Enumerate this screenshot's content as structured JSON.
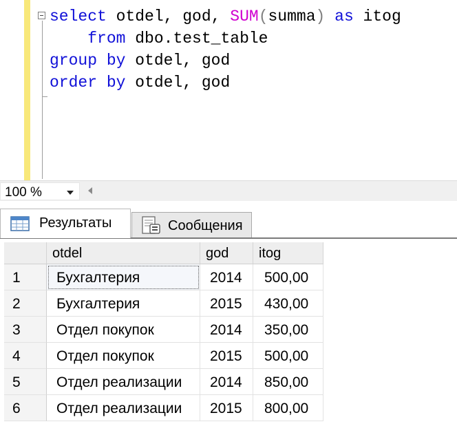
{
  "editor": {
    "lines": [
      {
        "parts": [
          {
            "t": "select",
            "c": "kw"
          },
          {
            "t": " otdel, god, ",
            "c": ""
          },
          {
            "t": "SUM",
            "c": "fn"
          },
          {
            "t": "(",
            "c": "op"
          },
          {
            "t": "summa",
            "c": ""
          },
          {
            "t": ")",
            "c": "op"
          },
          {
            "t": " ",
            "c": ""
          },
          {
            "t": "as",
            "c": "kw"
          },
          {
            "t": " itog",
            "c": ""
          }
        ]
      },
      {
        "parts": [
          {
            "t": "    ",
            "c": ""
          },
          {
            "t": "from",
            "c": "kw"
          },
          {
            "t": " dbo.test_table",
            "c": ""
          }
        ]
      },
      {
        "parts": [
          {
            "t": "group by",
            "c": "kw"
          },
          {
            "t": " otdel, god",
            "c": ""
          }
        ]
      },
      {
        "parts": [
          {
            "t": "order by",
            "c": "kw"
          },
          {
            "t": " otdel, god",
            "c": ""
          }
        ]
      }
    ]
  },
  "status": {
    "zoom": "100 %"
  },
  "tabs": {
    "results": "Результаты",
    "messages": "Сообщения"
  },
  "grid": {
    "columns": [
      "otdel",
      "god",
      "itog"
    ],
    "rows": [
      {
        "n": "1",
        "otdel": "Бухгалтерия",
        "god": "2014",
        "itog": "500,00"
      },
      {
        "n": "2",
        "otdel": "Бухгалтерия",
        "god": "2015",
        "itog": "430,00"
      },
      {
        "n": "3",
        "otdel": "Отдел покупок",
        "god": "2014",
        "itog": "350,00"
      },
      {
        "n": "4",
        "otdel": "Отдел покупок",
        "god": "2015",
        "itog": "500,00"
      },
      {
        "n": "5",
        "otdel": "Отдел реализации",
        "god": "2014",
        "itog": "850,00"
      },
      {
        "n": "6",
        "otdel": "Отдел реализации",
        "god": "2015",
        "itog": "800,00"
      }
    ]
  },
  "colors": {
    "keyword": "#1010d8",
    "function": "#d000d0",
    "gutter": "#f8e87a"
  }
}
